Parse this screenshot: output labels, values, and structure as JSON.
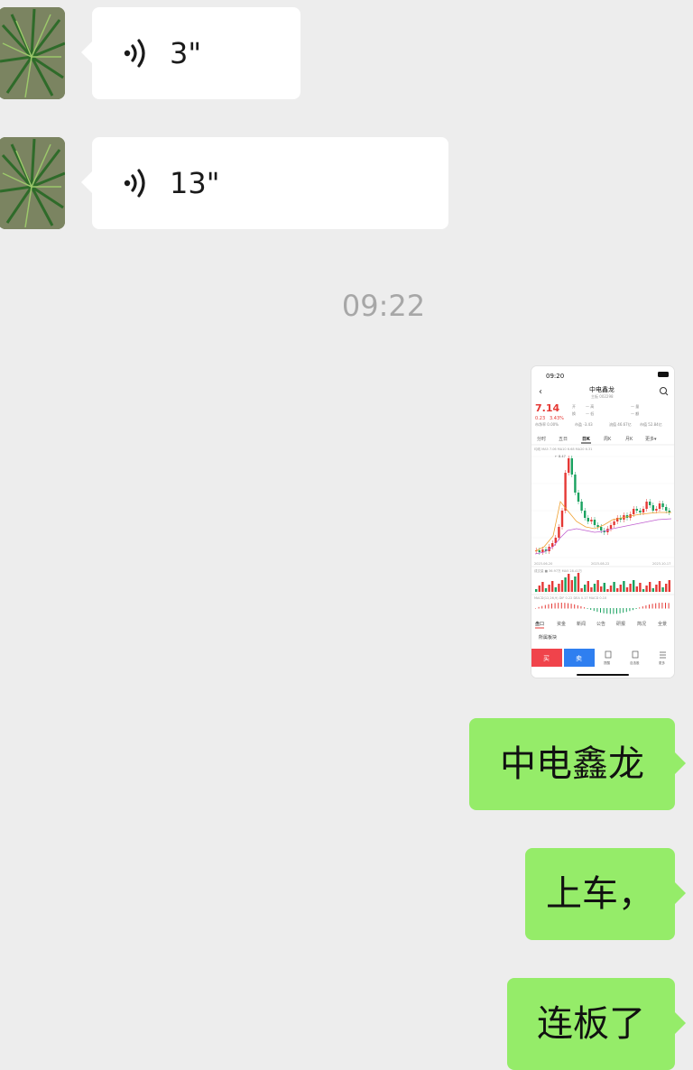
{
  "messages": {
    "voice_1": {
      "duration": "3\""
    },
    "voice_2": {
      "duration": "13\""
    },
    "timestamp": "09:22",
    "text_1": "中电鑫龙",
    "text_2": "上车，",
    "text_3": "连板了"
  },
  "screenshot": {
    "status_time": "09:20",
    "stock_name": "中电鑫龙",
    "price": "7.14",
    "change": "0.23",
    "change_pct": "3.43%",
    "tabs": [
      "分时",
      "五日",
      "日K",
      "周K",
      "月K",
      "更多"
    ],
    "bottom_tabs": [
      "盘口",
      "资金",
      "新闻",
      "公告",
      "研报",
      "简况",
      "全景"
    ],
    "sector_label": "所属板块",
    "buy_label": "买",
    "sell_label": "卖",
    "colors": {
      "up": "#e53935",
      "down": "#1aa260",
      "buy": "#f0434b",
      "sell": "#2f7ff0"
    }
  }
}
